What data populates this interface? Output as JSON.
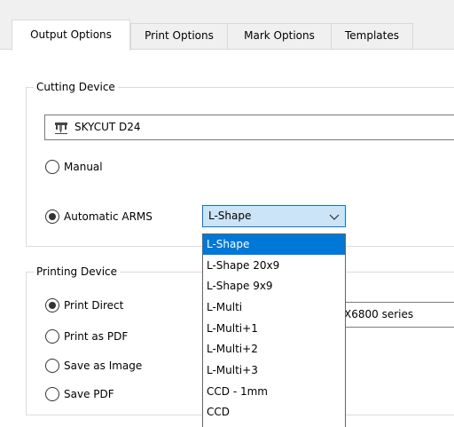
{
  "tabs": [
    {
      "label": "Output Options",
      "active": true
    },
    {
      "label": "Print Options",
      "active": false
    },
    {
      "label": "Mark Options",
      "active": false
    },
    {
      "label": "Templates",
      "active": false
    }
  ],
  "cutting_device": {
    "legend": "Cutting Device",
    "device_name": "SKYCUT D24",
    "device_icon": "plotter-icon",
    "options": {
      "manual": {
        "label": "Manual",
        "checked": false
      },
      "automatic": {
        "label": "Automatic ARMS",
        "checked": true
      }
    },
    "arms_select": {
      "value": "L-Shape",
      "options": [
        "L-Shape",
        "L-Shape 20x9",
        "L-Shape 9x9",
        "L-Multi",
        "L-Multi+1",
        "L-Multi+2",
        "L-Multi+3",
        "CCD - 1mm",
        "CCD"
      ],
      "highlighted_index": 0
    }
  },
  "printing_device": {
    "legend": "Printing Device",
    "printer_partial_text": "X6800 series",
    "options": {
      "print_direct": {
        "label": "Print Direct",
        "checked": true
      },
      "print_as_pdf": {
        "label": "Print as PDF",
        "checked": false
      },
      "save_as_image": {
        "label": "Save as Image",
        "checked": false
      },
      "save_pdf": {
        "label": "Save PDF",
        "checked": false
      }
    }
  },
  "colors": {
    "accent": "#0078d7",
    "select_bg": "#cce4f7",
    "panel_bg": "#ffffff",
    "window_bg": "#f0f0f0"
  }
}
